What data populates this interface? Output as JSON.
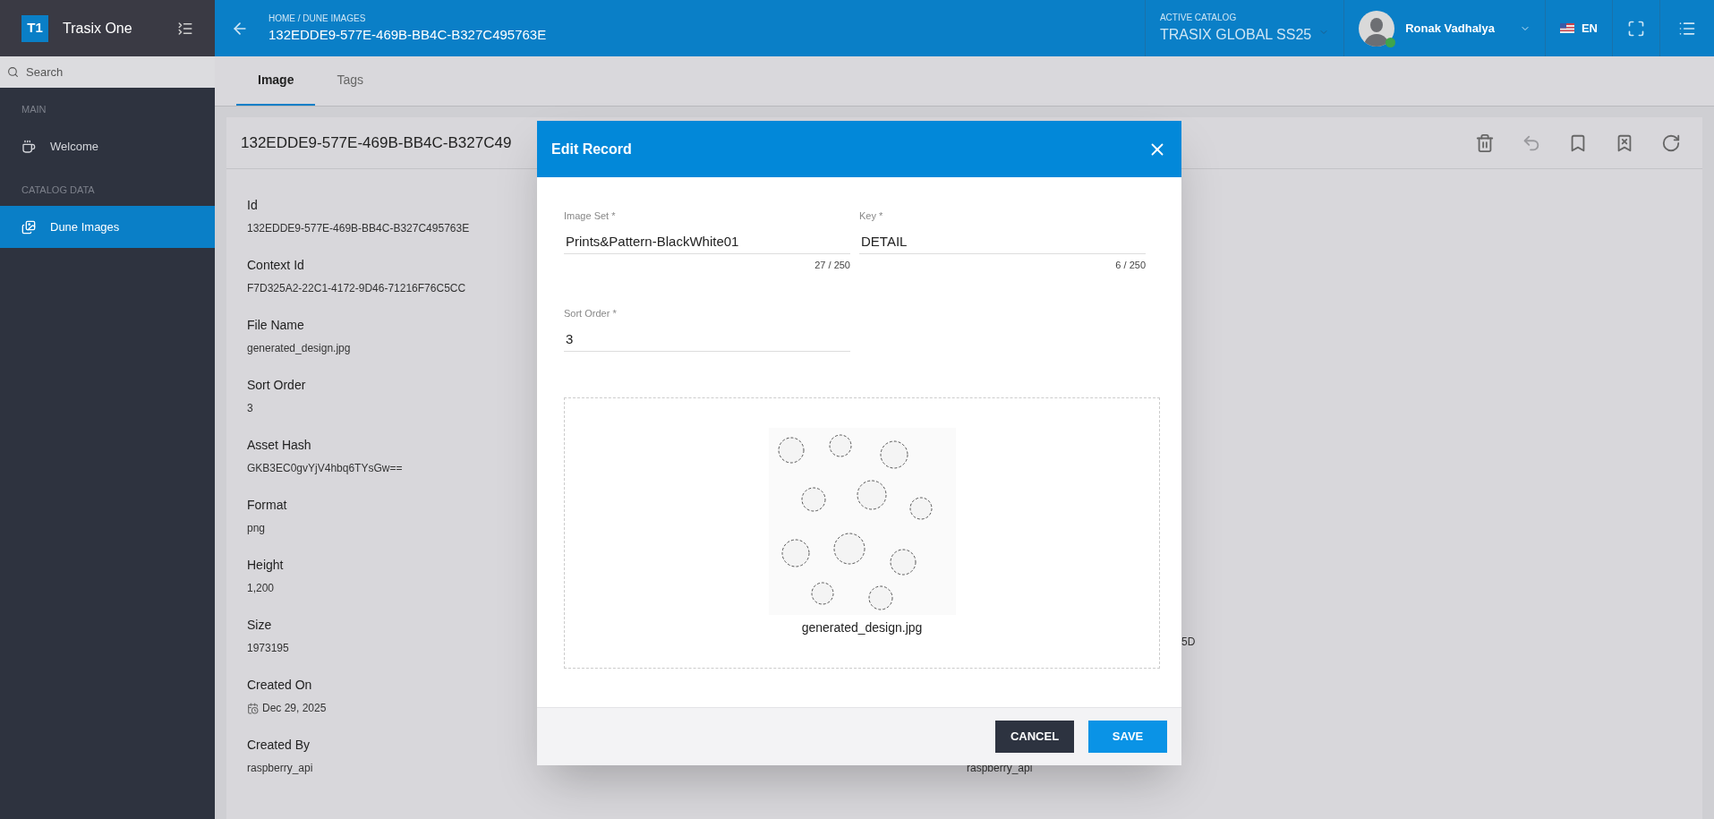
{
  "app": {
    "logo": "T1",
    "name": "Trasix One"
  },
  "sidebar": {
    "search_placeholder": "Search",
    "sections": [
      {
        "heading": "MAIN",
        "items": [
          {
            "label": "Welcome",
            "selected": false
          }
        ]
      },
      {
        "heading": "CATALOG DATA",
        "items": [
          {
            "label": "Dune Images",
            "selected": true
          }
        ]
      }
    ]
  },
  "header": {
    "breadcrumb": "HOME / DUNE IMAGES",
    "title": "132EDDE9-577E-469B-BB4C-B327C495763E",
    "catalog_label": "ACTIVE CATALOG",
    "catalog": "TRASIX GLOBAL SS25",
    "user": "Ronak Vadhalya",
    "user_online": true,
    "language": "EN"
  },
  "tabs": [
    {
      "label": "Image",
      "selected": true
    },
    {
      "label": "Tags",
      "selected": false
    }
  ],
  "record": {
    "title": "132EDDE9-577E-469B-BB4C-B327C49",
    "actions": [
      {
        "disabled": false
      },
      {
        "disabled": true
      },
      {
        "disabled": false
      },
      {
        "disabled": false
      },
      {
        "disabled": false
      }
    ],
    "fields": [
      {
        "label": "Id",
        "value": "132EDDE9-577E-469B-BB4C-B327C495763E",
        "kind": "text"
      },
      {
        "label": "Context Id",
        "value": "F7D325A2-22C1-4172-9D46-71216F76C5CC",
        "kind": "text"
      },
      {
        "label": "File Name",
        "value": "generated_design.jpg",
        "kind": "text"
      },
      {
        "label": "Sort Order",
        "value": "3",
        "kind": "text"
      },
      {
        "label": "Asset Hash",
        "value": "GKB3EC0gvYjV4hbq6TYsGw==",
        "kind": "text"
      },
      {
        "label": "Format",
        "value": "png",
        "kind": "text"
      },
      {
        "label": "Height",
        "value": "1,200",
        "kind": "text"
      },
      {
        "label": "Size",
        "value": "1973195",
        "kind": "text"
      },
      {
        "label": "Created On",
        "value": "Dec 29, 2025",
        "kind": "date"
      },
      {
        "label": "Created By",
        "value": "raspberry_api",
        "kind": "text"
      }
    ],
    "right_values": [
      "5D",
      "raspberry_api"
    ]
  },
  "modal": {
    "title": "Edit Record",
    "fields": [
      {
        "label": "Image Set *",
        "value": "Prints&Pattern-BlackWhite01",
        "counter": "27 / 250"
      },
      {
        "label": "Key *",
        "value": "DETAIL",
        "counter": "6 / 250"
      },
      {
        "label": "Sort Order *",
        "value": "3"
      }
    ],
    "upload": {
      "file_name": "generated_design.jpg"
    },
    "buttons": [
      {
        "label": "CANCEL",
        "kind": "secondary"
      },
      {
        "label": "SAVE",
        "kind": "primary"
      }
    ]
  }
}
